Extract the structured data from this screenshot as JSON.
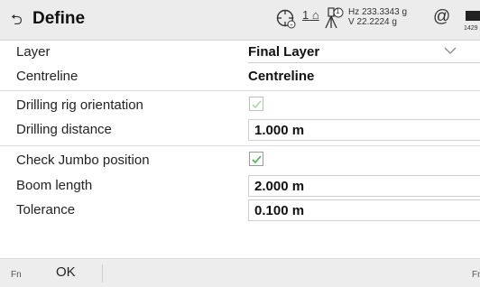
{
  "header": {
    "title": "Define",
    "back_icon": "back-arrow-icon",
    "status": {
      "target_icon": "target-crosshair-icon",
      "reflector_label": "1",
      "instrument_icon": "instrument-tripod-icon",
      "instrument_badge": "1",
      "hz": "Hz 233.3343 g",
      "v": "V  22.2224 g",
      "connection_icon": "at-icon",
      "battery_icon": "battery-icon",
      "battery_time": "1429"
    }
  },
  "fields": [
    {
      "label": "Layer",
      "value": "Final Layer",
      "type": "dropdown"
    },
    {
      "label": "Centreline",
      "value": "Centreline",
      "type": "readonly"
    },
    {
      "label": "Drilling rig orientation",
      "checked": true,
      "enabled": false,
      "type": "checkbox"
    },
    {
      "label": "Drilling distance",
      "value": "1.000 m",
      "type": "input"
    },
    {
      "label": "Check Jumbo position",
      "checked": true,
      "enabled": true,
      "type": "checkbox"
    },
    {
      "label": "Boom length",
      "value": "2.000 m",
      "type": "input"
    },
    {
      "label": "Tolerance",
      "value": "0.100 m",
      "type": "input"
    }
  ],
  "footer": {
    "fn_left": "Fn",
    "ok_label": "OK",
    "fn_right": "Fn"
  },
  "colors": {
    "check_disabled": "#9fd19a",
    "check_enabled": "#4caf50",
    "titlebar_bg": "#ececec"
  }
}
